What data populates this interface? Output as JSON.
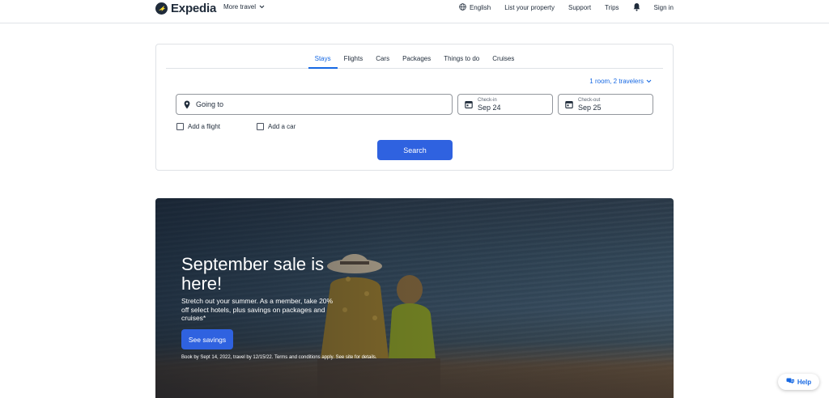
{
  "header": {
    "brand": "Expedia",
    "more_travel": "More travel",
    "language": "English",
    "list_property": "List your property",
    "support": "Support",
    "trips": "Trips",
    "sign_in": "Sign in"
  },
  "search": {
    "tabs": [
      {
        "label": "Stays",
        "active": true
      },
      {
        "label": "Flights",
        "active": false
      },
      {
        "label": "Cars",
        "active": false
      },
      {
        "label": "Packages",
        "active": false
      },
      {
        "label": "Things to do",
        "active": false
      },
      {
        "label": "Cruises",
        "active": false
      }
    ],
    "travelers": "1 room, 2 travelers",
    "going_to": "Going to",
    "check_in_label": "Check-in",
    "check_in_value": "Sep 24",
    "check_out_label": "Check-out",
    "check_out_value": "Sep 25",
    "add_flight": "Add a flight",
    "add_car": "Add a car",
    "button": "Search"
  },
  "hero": {
    "title": "September sale is here!",
    "description": "Stretch out your summer. As a member, take 20% off select hotels, plus savings on packages and cruises*",
    "button": "See savings",
    "fine_print": "Book by Sept 14, 2022, travel by 12/15/22. Terms and conditions apply. See site for details."
  },
  "help": {
    "label": "Help"
  },
  "colors": {
    "accent": "#1668e3",
    "button": "#2f62e0",
    "text": "#1f2b3a",
    "border": "#dfe2e6"
  },
  "icons": [
    "expedia-logo-icon",
    "chevron-down-icon",
    "globe-icon",
    "bell-icon",
    "location-pin-icon",
    "calendar-icon",
    "chat-icon"
  ]
}
